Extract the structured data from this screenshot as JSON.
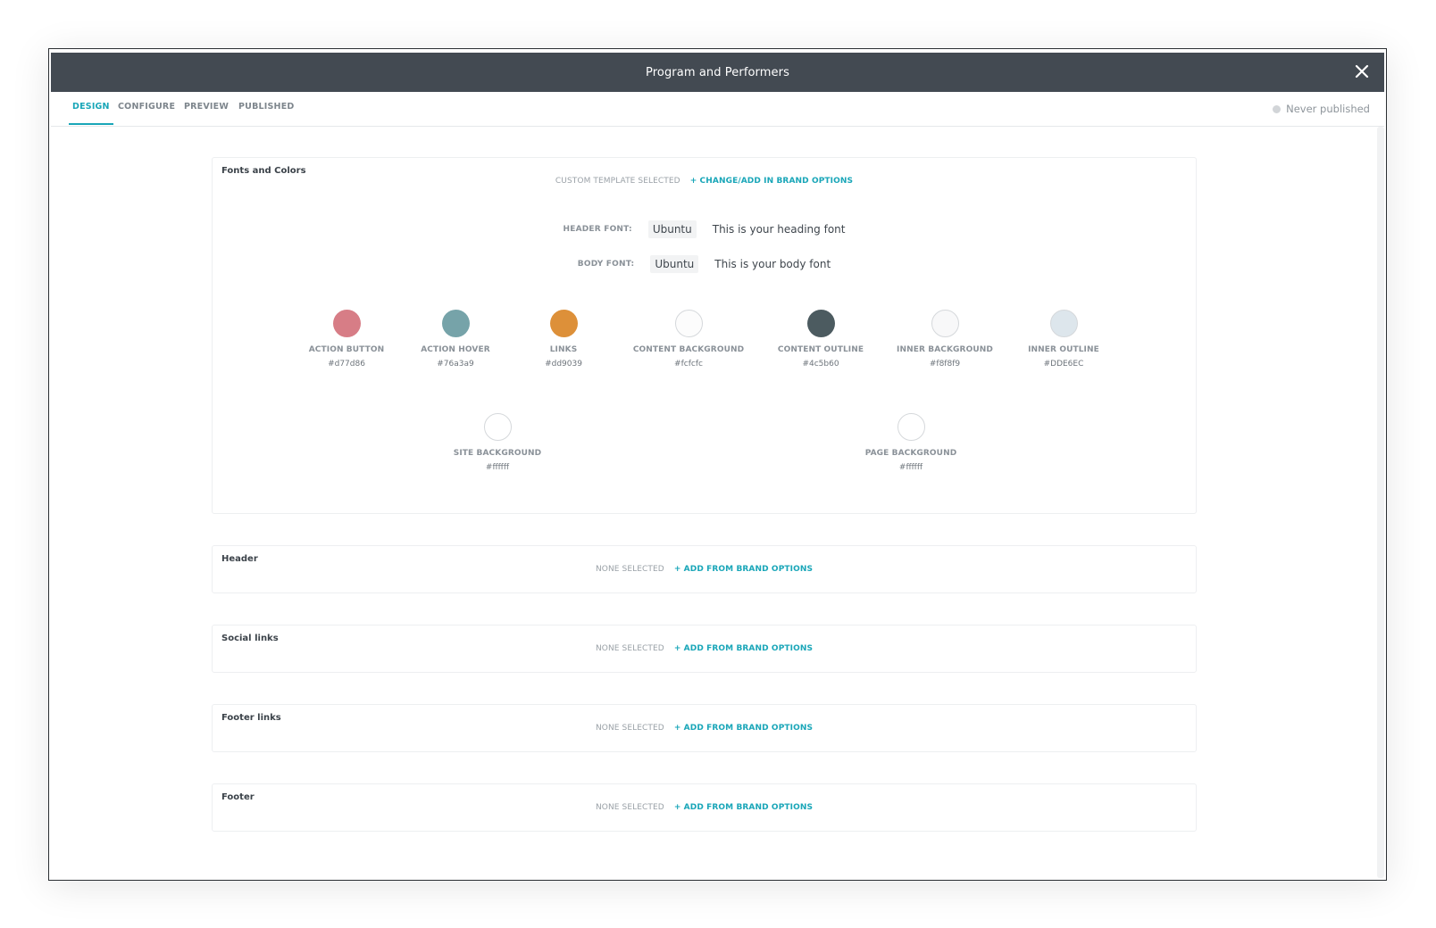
{
  "window": {
    "title": "Program and Performers"
  },
  "tabs": [
    {
      "label": "DESIGN",
      "active": true
    },
    {
      "label": "CONFIGURE",
      "active": false
    },
    {
      "label": "PREVIEW",
      "active": false
    },
    {
      "label": "PUBLISHED",
      "active": false
    }
  ],
  "publish_status": "Never published",
  "fonts_colors": {
    "title": "Fonts and Colors",
    "template_status": "CUSTOM TEMPLATE SELECTED",
    "template_link": "+ CHANGE/ADD IN BRAND OPTIONS",
    "header_font": {
      "label": "HEADER FONT:",
      "value": "Ubuntu",
      "preview": "This is your heading font"
    },
    "body_font": {
      "label": "BODY FONT:",
      "value": "Ubuntu",
      "preview": "This is your body font"
    },
    "colors": [
      {
        "name": "ACTION BUTTON",
        "hex": "#d77d86",
        "color": "#d77d86"
      },
      {
        "name": "ACTION HOVER",
        "hex": "#76a3a9",
        "color": "#76a3a9"
      },
      {
        "name": "LINKS",
        "hex": "#dd9039",
        "color": "#dd9039"
      },
      {
        "name": "CONTENT BACKGROUND",
        "hex": "#fcfcfc",
        "color": "#fcfcfc"
      },
      {
        "name": "CONTENT OUTLINE",
        "hex": "#4c5b60",
        "color": "#4c5b60"
      },
      {
        "name": "INNER BACKGROUND",
        "hex": "#f8f8f9",
        "color": "#f8f8f9"
      },
      {
        "name": "INNER OUTLINE",
        "hex": "#DDE6EC",
        "color": "#DDE6EC"
      }
    ],
    "colors_row2": [
      {
        "name": "SITE BACKGROUND",
        "hex": "#ffffff",
        "color": "#ffffff"
      },
      {
        "name": "PAGE BACKGROUND",
        "hex": "#ffffff",
        "color": "#ffffff"
      }
    ]
  },
  "sections": [
    {
      "title": "Header",
      "status": "NONE SELECTED",
      "link": "+ ADD FROM BRAND OPTIONS"
    },
    {
      "title": "Social links",
      "status": "NONE SELECTED",
      "link": "+ ADD FROM BRAND OPTIONS"
    },
    {
      "title": "Footer links",
      "status": "NONE SELECTED",
      "link": "+ ADD FROM BRAND OPTIONS"
    },
    {
      "title": "Footer",
      "status": "NONE SELECTED",
      "link": "+ ADD FROM BRAND OPTIONS"
    }
  ],
  "icons": {
    "close": "close-icon",
    "status_dot": "status-dot-icon"
  }
}
